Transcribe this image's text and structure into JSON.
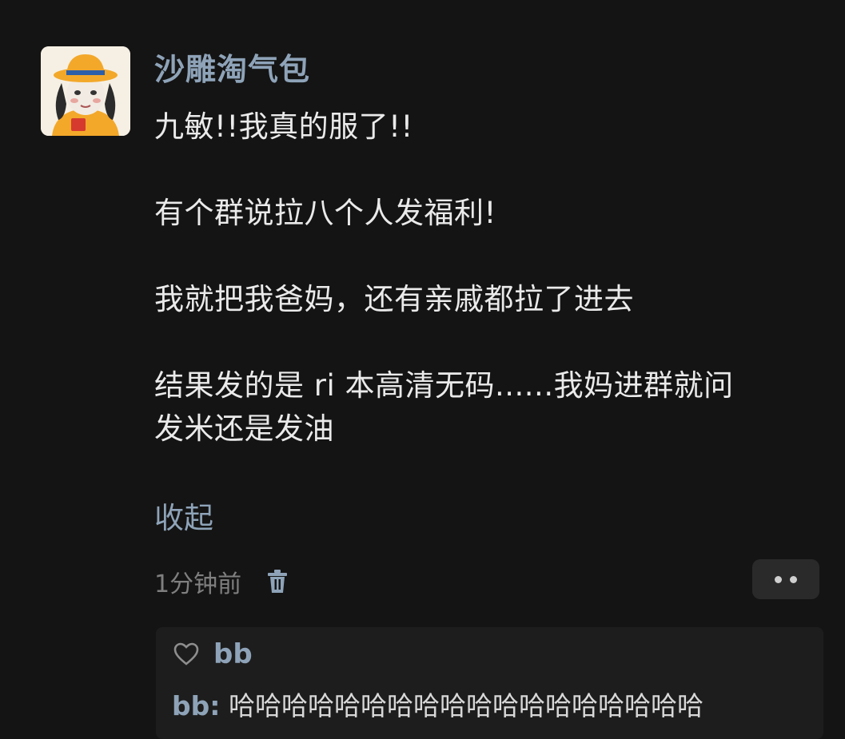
{
  "comment": {
    "username": "沙雕淘气包",
    "body": "九敏!!我真的服了!!\n\n有个群说拉八个人发福利!\n\n我就把我爸妈，还有亲戚都拉了进去\n\n结果发的是 ri 本高清无码......我妈进群就问\n发米还是发油",
    "collapse_label": "收起",
    "timestamp": "1分钟前",
    "icons": {
      "avatar": "cartoon-girl-avatar",
      "delete": "trash-icon",
      "more": "more-dots-icon"
    }
  },
  "reply": {
    "liker_name": "bb",
    "author": "bb:",
    "text": "哈哈哈哈哈哈哈哈哈哈哈哈哈哈哈哈哈哈",
    "icons": {
      "like": "heart-icon"
    }
  },
  "colors": {
    "background": "#141414",
    "name_accent": "#8ea3b8",
    "body_text": "#eaeaea",
    "muted": "#7f7f7f"
  }
}
